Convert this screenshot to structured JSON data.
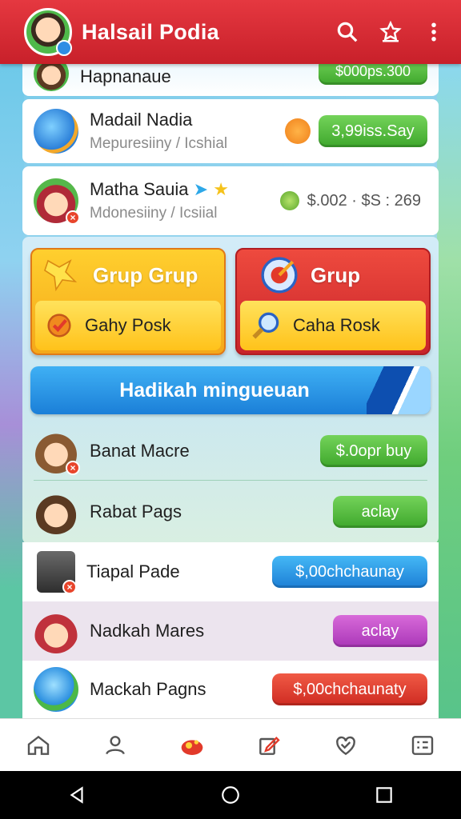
{
  "app": {
    "title": "Halsail Podia"
  },
  "list_top": [
    {
      "name": "Hapnanaue",
      "price": "$000ps.300"
    },
    {
      "name": "Madail Nadia",
      "sub": "Mepuresiiny / Icshial",
      "price": "3,99iss.Say"
    },
    {
      "name": "Matha Sauia",
      "sub": "Mdonesiiny / Icsiial",
      "price": "$.002 · $S : 269"
    }
  ],
  "tiles": {
    "left": {
      "title": "Grup Grup",
      "action": "Gahy Posk"
    },
    "right": {
      "title": "Grup",
      "action": "Caha Rosk"
    }
  },
  "banner": {
    "label": "Hadikah mingueuan"
  },
  "list_bottom": [
    {
      "name": "Banat Macre",
      "button": "$.0opr buy",
      "color": "#3ea72c"
    },
    {
      "name": "Rabat Pags",
      "button": "aclay",
      "color": "#3ea72c"
    },
    {
      "name": "Tiapal Pade",
      "button": "$,00chchaunay",
      "color": "#1d7fd6"
    },
    {
      "name": "Nadkah Mares",
      "button": "aclay",
      "color": "#aa37b8"
    },
    {
      "name": "Mackah Pagns",
      "button": "$,00chchaunaty",
      "color": "#cf2b22"
    }
  ],
  "icons": {
    "header": [
      "search-icon",
      "star-badge-icon",
      "more-vert-icon"
    ],
    "tabs": [
      "home-icon",
      "profile-icon",
      "game-icon",
      "edit-icon",
      "heart-icon",
      "grid-list-icon"
    ],
    "nav": [
      "back-icon",
      "home-circle-icon",
      "recents-icon"
    ]
  }
}
